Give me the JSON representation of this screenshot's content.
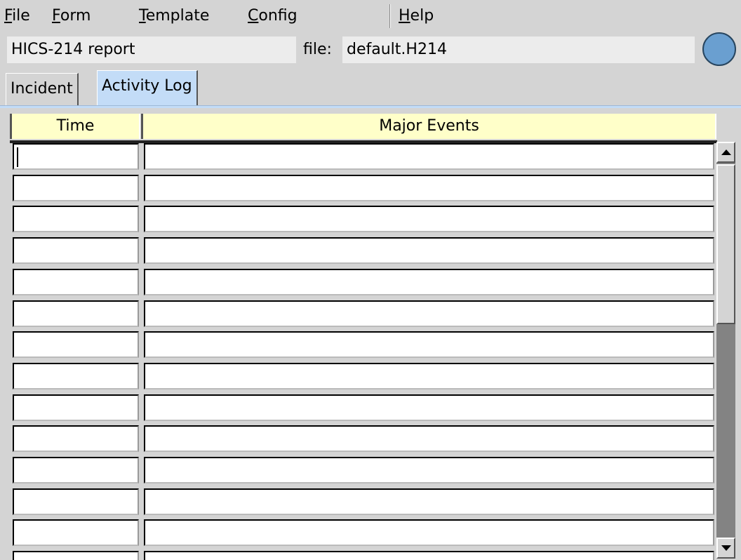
{
  "menu": {
    "file": {
      "mnemonic": "F",
      "rest": "ile"
    },
    "form": {
      "mnemonic": "F",
      "rest": "orm"
    },
    "template": {
      "mnemonic": "T",
      "rest": "emplate"
    },
    "config": {
      "mnemonic": "C",
      "rest": "onfig"
    },
    "help": {
      "mnemonic": "H",
      "rest": "elp"
    }
  },
  "header": {
    "report_title": "HICS-214 report",
    "file_label": "file:",
    "file_name": "default.H214",
    "status_light_color": "#6a9fd0"
  },
  "tabs": [
    {
      "label": "Incident",
      "active": false
    },
    {
      "label": "Activity Log",
      "active": true
    }
  ],
  "table": {
    "columns": [
      "Time",
      "Major Events"
    ],
    "rows": [
      {
        "time": "",
        "event": ""
      },
      {
        "time": "",
        "event": ""
      },
      {
        "time": "",
        "event": ""
      },
      {
        "time": "",
        "event": ""
      },
      {
        "time": "",
        "event": ""
      },
      {
        "time": "",
        "event": ""
      },
      {
        "time": "",
        "event": ""
      },
      {
        "time": "",
        "event": ""
      },
      {
        "time": "",
        "event": ""
      },
      {
        "time": "",
        "event": ""
      },
      {
        "time": "",
        "event": ""
      },
      {
        "time": "",
        "event": ""
      },
      {
        "time": "",
        "event": ""
      },
      {
        "time": "",
        "event": ""
      }
    ]
  },
  "scrollbar": {
    "up_icon": "up-arrow-icon",
    "down_icon": "down-arrow-icon"
  }
}
